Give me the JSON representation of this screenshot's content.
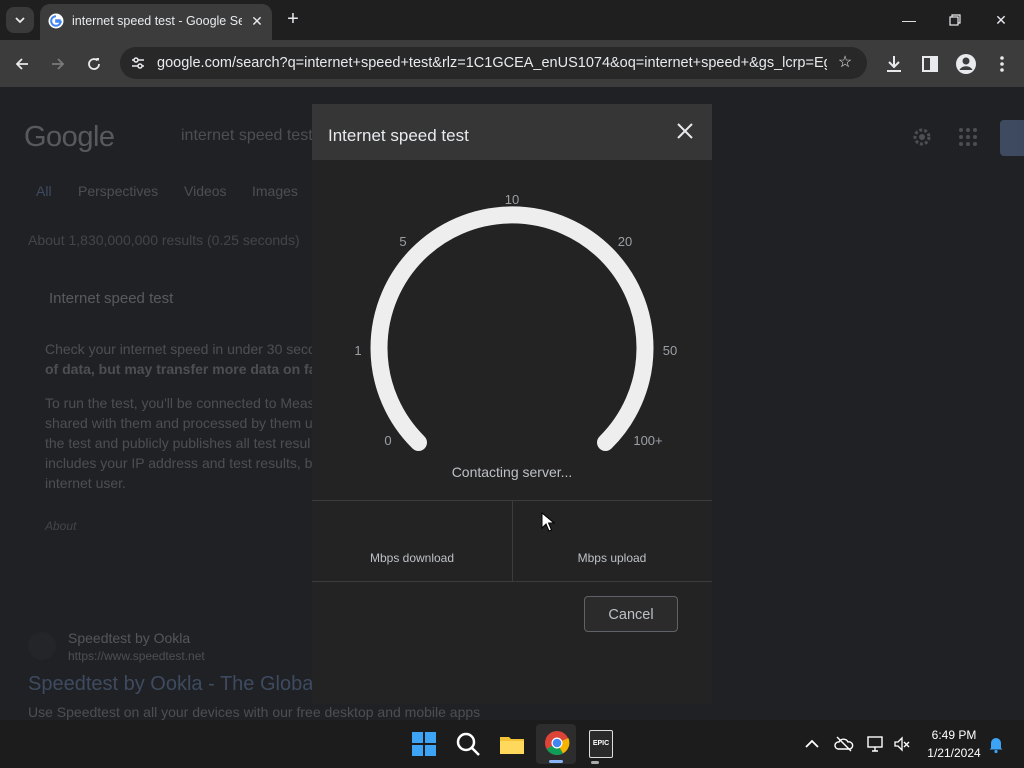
{
  "browser": {
    "tab_title": "internet speed test - Google Search",
    "url": "google.com/search?q=internet+speed+test&rlz=1C1GCEA_enUS1074&oq=internet+speed+&gs_lcrp=EgZ..."
  },
  "search_page": {
    "logo": "Google",
    "query": "internet speed test",
    "tabs": [
      "All",
      "Perspectives",
      "Videos",
      "Images"
    ],
    "stats": "About 1,830,000,000 results (0.25 seconds)",
    "card_title": "Internet speed test",
    "card_lines": [
      "Check your internet speed in under 30 seco",
      "of data, but may transfer more data on fast",
      "To run the test, you'll be connected to Meas",
      "shared with them and processed by them u",
      "the test and publicly publishes all test resul",
      "includes your IP address and test results, b",
      "internet user."
    ],
    "about": "About",
    "result_site": "Speedtest by Ookla",
    "result_url": "https://www.speedtest.net",
    "result_title": "Speedtest by Ookla - The Globa",
    "result_desc": "Use Speedtest on all your devices with our free desktop and mobile apps"
  },
  "dialog": {
    "title": "Internet speed test",
    "gauge_labels": [
      "0",
      "1",
      "5",
      "10",
      "20",
      "50",
      "100+"
    ],
    "status": "Contacting server...",
    "download_label": "Mbps download",
    "upload_label": "Mbps upload",
    "cancel_label": "Cancel"
  },
  "taskbar": {
    "time": "6:49 PM",
    "date": "1/21/2024",
    "epic_label": "EPIC"
  },
  "icons": {
    "tab_menu": "chevron-down-icon",
    "new_tab": "plus-icon",
    "back": "arrow-left-icon",
    "forward": "arrow-right-icon",
    "reload": "reload-icon",
    "site_info": "tune-icon",
    "bookmark": "star-icon",
    "download": "download-icon",
    "side_panel": "side-panel-icon",
    "profile": "profile-icon",
    "menu": "kebab-menu-icon",
    "close": "close-icon"
  },
  "colors": {
    "accent": "#8ab4f8",
    "dialog_bg": "#232323",
    "dialog_header": "#363636",
    "gauge_arc": "#eeeeee"
  }
}
